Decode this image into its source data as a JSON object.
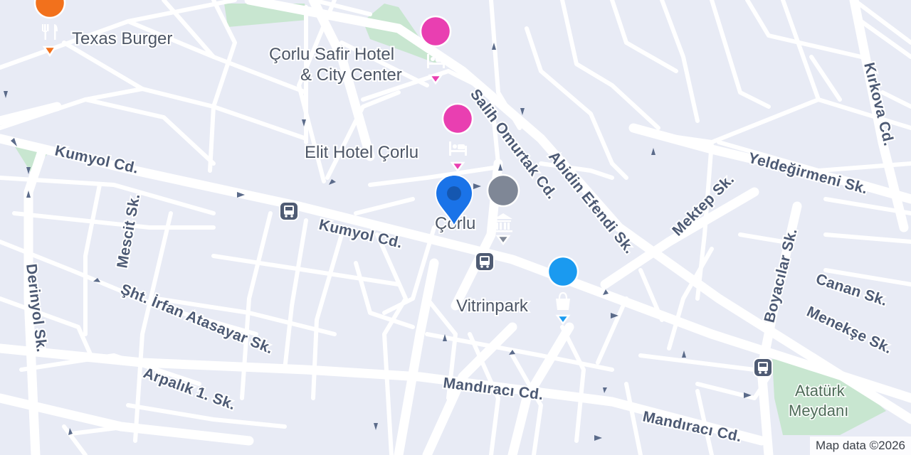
{
  "map": {
    "attribution": "Map data ©2026",
    "streets": {
      "kumyol_1": "Kumyol Cd.",
      "kumyol_2": "Kumyol Cd.",
      "salih": "Salih Omurtak Cd.",
      "abidin": "Abidin Efendi Sk.",
      "mektep": "Mektep Sk.",
      "yeldegirmeni": "Yeldeğirmeni Sk.",
      "kirkova": "Kırkova Cd.",
      "boyacilar": "Boyacılar Sk.",
      "canan": "Canan Sk.",
      "menekse": "Menekşe Sk.",
      "mescit": "Mescit Sk.",
      "derinyol": "Derinyol Sk.",
      "irfan": "Şht. İrfan Atasayar Sk.",
      "arpalik": "Arpalık 1. Sk.",
      "mandiraci_1": "Mandıracı Cd.",
      "mandiraci_2": "Mandıracı Cd."
    },
    "places": {
      "texas_burger": {
        "name": "Texas Burger",
        "icon": "restaurant-icon",
        "color": "#f2711c"
      },
      "safir_hotel": {
        "line1": "Çorlu Safir Hotel",
        "line2": "& City Center",
        "icon": "hotel-icon",
        "color": "#e93fb1"
      },
      "elit_hotel": {
        "name": "Elit Hotel Çorlu",
        "icon": "hotel-icon",
        "color": "#e93fb1"
      },
      "corlu": {
        "name": "Çorlu",
        "icon": "government-building-icon",
        "color": "#7f8796"
      },
      "vitrinpark": {
        "name": "Vitrinpark",
        "icon": "shopping-bag-icon",
        "color": "#1a9af0"
      },
      "ataturk": {
        "line1": "Atatürk",
        "line2": "Meydanı",
        "color": "#c8e6d0"
      }
    },
    "location_pin_color": "#1a73e8",
    "bus_stop_icon": "bus-stop-icon",
    "colors": {
      "land": "#e8ebf5",
      "road": "#ffffff",
      "park": "#c8e6d0",
      "label": "#4d5a74"
    }
  }
}
